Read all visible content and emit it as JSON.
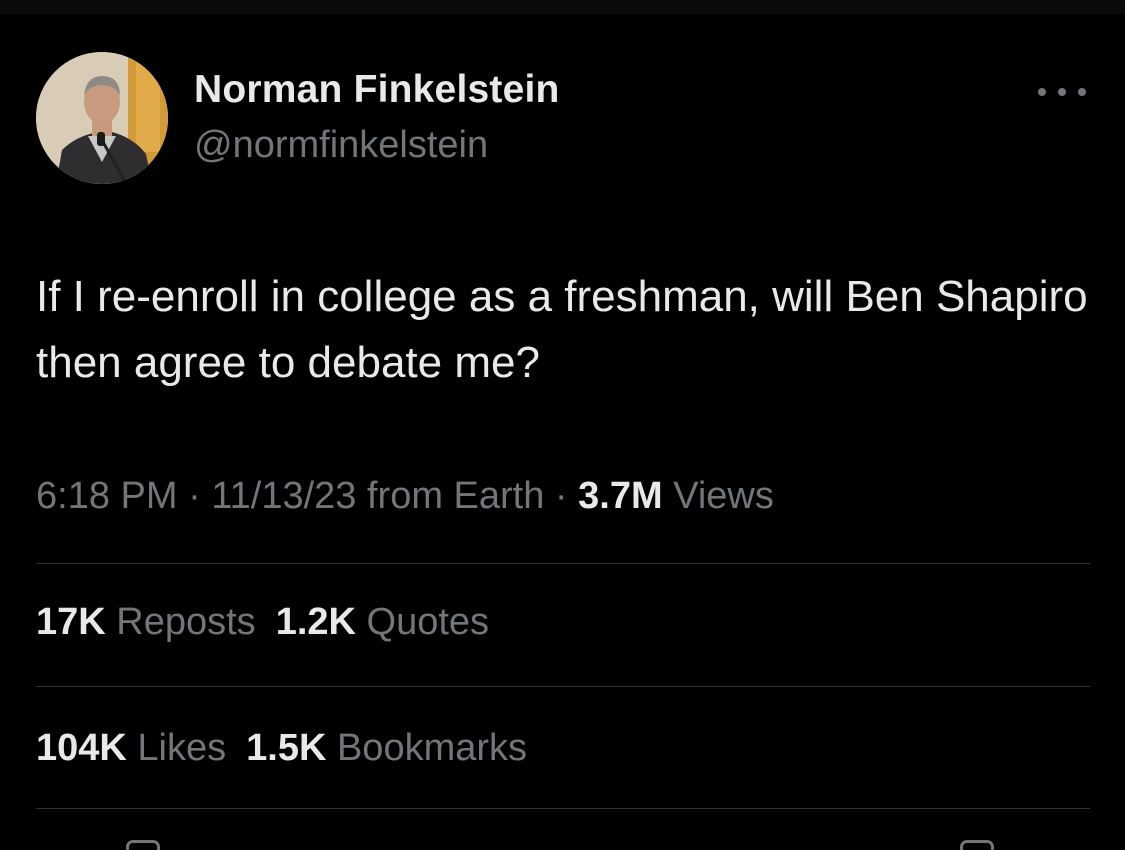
{
  "user": {
    "display_name": "Norman Finkelstein",
    "handle": "@normfinkelstein",
    "avatar_icon": "profile-photo-man-at-microphone"
  },
  "tweet": {
    "text": "If I re-enroll in college as a freshman, will Ben Shapiro then agree to debate me?"
  },
  "meta": {
    "time": "6:18 PM",
    "sep1": " · ",
    "date": "11/13/23",
    "source": " from Earth",
    "sep2": " · ",
    "views_count": "3.7M",
    "views_label": " Views"
  },
  "stats": {
    "reposts_count": "17K",
    "reposts_label": " Reposts",
    "quotes_count": "1.2K",
    "quotes_label": " Quotes",
    "likes_count": "104K",
    "likes_label": " Likes",
    "bookmarks_count": "1.5K",
    "bookmarks_label": " Bookmarks"
  },
  "icons": {
    "more": "more-options-icon"
  },
  "colors": {
    "background": "#000000",
    "primary_text": "#e7e9ea",
    "secondary_text": "#71767b",
    "divider": "#2f3336"
  }
}
